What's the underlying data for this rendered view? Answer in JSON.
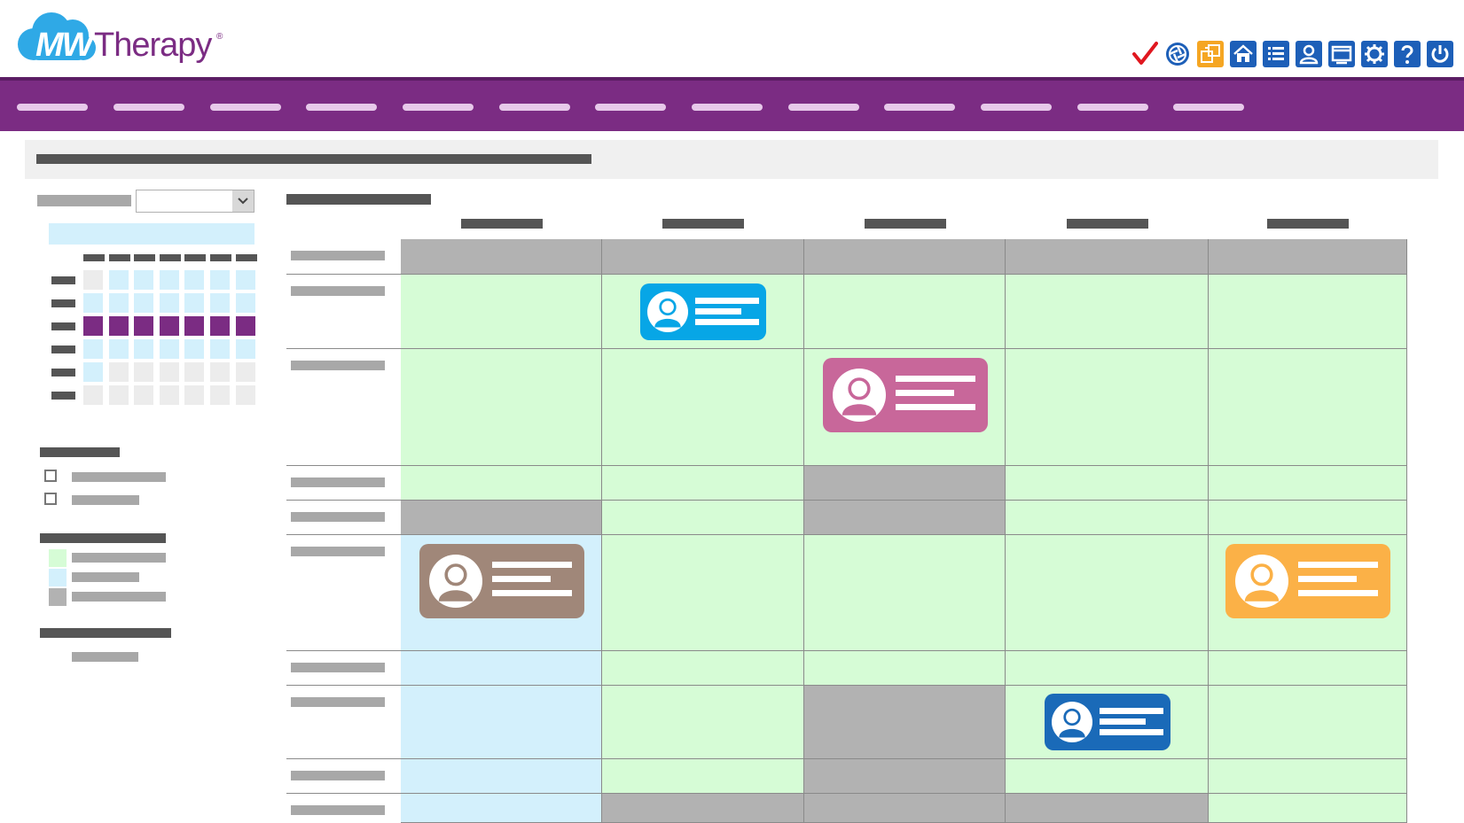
{
  "app": {
    "logo_mw": "MW",
    "logo_word": "Therapy",
    "logo_reg": "®"
  },
  "toolbar": {
    "icons": [
      "checkmark-icon",
      "aperture-icon",
      "transfer-icon",
      "home-icon",
      "list-icon",
      "user-icon",
      "window-icon",
      "gear-icon",
      "help-icon",
      "power-icon"
    ]
  },
  "colors": {
    "brand_purple": "#7b2c83",
    "toolbar_blue": "#1d5fb8",
    "available": "#d6fcd6",
    "alt_available": "#d3f0fc",
    "unavailable": "#b2b2b2",
    "card_blue": "#07a6e6",
    "card_pink": "#c8679a",
    "card_brown": "#a08779",
    "card_orange": "#fbb147",
    "card_darkblue": "#1a6ab8"
  },
  "legend": {
    "swatches": [
      "#d6fcd6",
      "#d3f0fc",
      "#b2b2b2"
    ]
  },
  "schedule": {
    "days": 5,
    "rows": 11,
    "cells": [
      [
        "u",
        "u",
        "u",
        "u",
        "u"
      ],
      [
        "a",
        "a",
        "a",
        "a",
        "a"
      ],
      [
        "a",
        "a",
        "a",
        "a",
        "a"
      ],
      [
        "a",
        "a",
        "u",
        "a",
        "a"
      ],
      [
        "u",
        "a",
        "u",
        "a",
        "a"
      ],
      [
        "b",
        "a",
        "a",
        "a",
        "a"
      ],
      [
        "b",
        "a",
        "a",
        "a",
        "a"
      ],
      [
        "b",
        "a",
        "u",
        "a",
        "a"
      ],
      [
        "b",
        "a",
        "u",
        "a",
        "a"
      ],
      [
        "b",
        "u",
        "u",
        "u",
        "a"
      ]
    ],
    "appointments": [
      {
        "row": 1,
        "col": 1,
        "color": "#07a6e6"
      },
      {
        "row": 2,
        "col": 2,
        "color": "#c8679a"
      },
      {
        "row": 5,
        "col": 0,
        "color": "#a08779"
      },
      {
        "row": 5,
        "col": 4,
        "color": "#fbb147"
      },
      {
        "row": 7,
        "col": 3,
        "color": "#1a6ab8"
      }
    ]
  }
}
